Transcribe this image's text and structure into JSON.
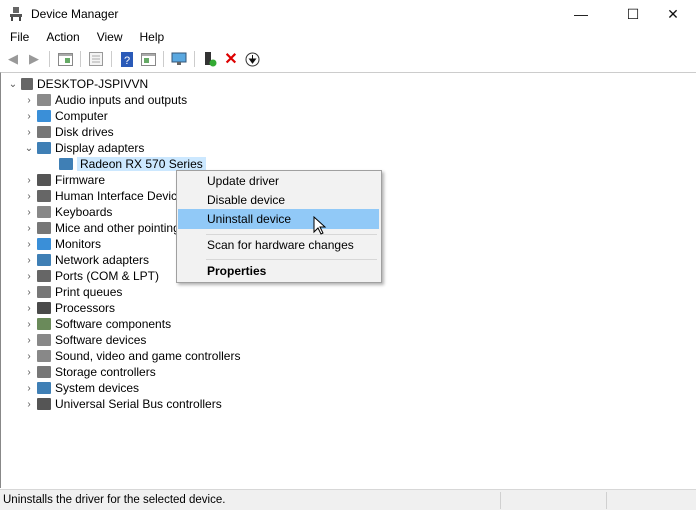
{
  "window": {
    "title": "Device Manager",
    "minimize": "—",
    "maximize": "☐",
    "close": "✕"
  },
  "menu": [
    "File",
    "Action",
    "View",
    "Help"
  ],
  "toolbar": [
    "back-icon",
    "forward-icon",
    "properties-pane-icon",
    "show-hide-console-tree-icon",
    "help-icon",
    "action-pane-icon",
    "monitor-icon",
    "add-driver-icon",
    "uninstall-x-icon",
    "update-driver-icon"
  ],
  "tree": {
    "root": "DESKTOP-JSPIVVN",
    "categories": [
      {
        "label": "Audio inputs and outputs",
        "color": "#8a8a8a"
      },
      {
        "label": "Computer",
        "color": "#3a8fd8"
      },
      {
        "label": "Disk drives",
        "color": "#777"
      },
      {
        "label": "Display adapters",
        "color": "#3f7fb5",
        "expanded": true,
        "children": [
          "Radeon RX 570 Series"
        ]
      },
      {
        "label": "Firmware",
        "color": "#555"
      },
      {
        "label": "Human Interface Devices",
        "color": "#666"
      },
      {
        "label": "Keyboards",
        "color": "#888"
      },
      {
        "label": "Mice and other pointing devices",
        "color": "#777"
      },
      {
        "label": "Monitors",
        "color": "#3a8fd8"
      },
      {
        "label": "Network adapters",
        "color": "#3f7fb5"
      },
      {
        "label": "Ports (COM & LPT)",
        "color": "#666"
      },
      {
        "label": "Print queues",
        "color": "#777"
      },
      {
        "label": "Processors",
        "color": "#4a4a4a"
      },
      {
        "label": "Software components",
        "color": "#6a8a5a"
      },
      {
        "label": "Software devices",
        "color": "#888"
      },
      {
        "label": "Sound, video and game controllers",
        "color": "#888"
      },
      {
        "label": "Storage controllers",
        "color": "#777"
      },
      {
        "label": "System devices",
        "color": "#3f7fb5"
      },
      {
        "label": "Universal Serial Bus controllers",
        "color": "#555"
      }
    ]
  },
  "context_menu": {
    "items": [
      "Update driver",
      "Disable device",
      "Uninstall device",
      "Scan for hardware changes",
      "Properties"
    ],
    "highlighted": "Uninstall device",
    "highlight_color": "#91c9f7"
  },
  "status": {
    "text": "Uninstalls the driver for the selected device."
  }
}
